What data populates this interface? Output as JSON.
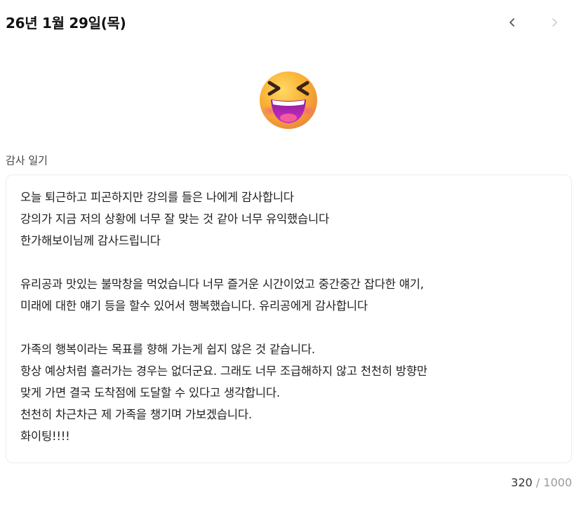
{
  "header": {
    "date_title": "26년 1월 29일(목)"
  },
  "mood": {
    "emoji_icon": "grinning-squinting-face-icon"
  },
  "diary": {
    "section_label": "감사 일기",
    "lines": [
      "오늘 퇴근하고 피곤하지만 강의를 들은 나에게 감사합니다",
      "강의가 지금 저의 상황에 너무 잘 맞는 것 같아 너무 유익했습니다",
      "한가해보이님께 감사드립니다",
      "",
      "유리공과 맛있는 불막창을 먹었습니다 너무 즐거운 시간이었고 중간중간 잡다한 얘기,",
      "미래에 대한 얘기 등을 할수 있어서 행복했습니다. 유리공에게 감사합니다",
      "",
      "가족의 행복이라는 목표를 향해 가는게 쉽지 않은 것 같습니다.",
      "항상 예상처럼 흘러가는 경우는 없더군요. 그래도 너무 조급해하지 않고 천천히 방향만",
      "맞게 가면 결국 도착점에 도달할 수 있다고 생각합니다.",
      "천천히 차근차근 제 가족을 챙기며 가보겠습니다.",
      "화이팅!!!!"
    ]
  },
  "counter": {
    "current": "320",
    "separator": " / ",
    "max": "1000"
  },
  "colors": {
    "border": "#ececec",
    "text": "#1f1f1f",
    "muted": "#9a9a9a",
    "emoji_face": "#f7b531",
    "emoji_cheek": "#f26b8a",
    "emoji_mouth": "#c026d3"
  }
}
